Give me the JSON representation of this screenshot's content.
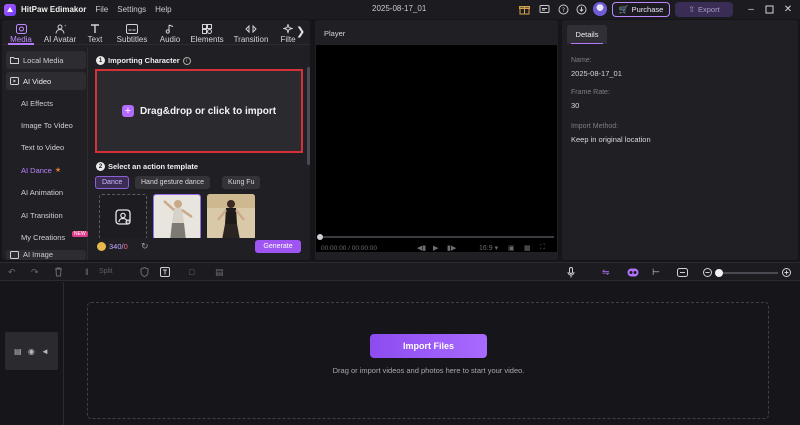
{
  "titlebar": {
    "app_name": "HitPaw Edimakor",
    "menu": [
      "File",
      "Settings",
      "Help"
    ],
    "project_title": "2025-08-17_01",
    "purchase_label": "Purchase",
    "export_label": "Export"
  },
  "tabs": [
    {
      "label": "Media",
      "icon": "media-icon",
      "active": true
    },
    {
      "label": "AI Avatar",
      "icon": "ai-avatar-icon"
    },
    {
      "label": "Text",
      "icon": "text-icon"
    },
    {
      "label": "Subtitles",
      "icon": "subtitles-icon"
    },
    {
      "label": "Audio",
      "icon": "audio-icon"
    },
    {
      "label": "Elements",
      "icon": "elements-icon"
    },
    {
      "label": "Transition",
      "icon": "transition-icon"
    },
    {
      "label": "Filte",
      "icon": "filter-icon"
    }
  ],
  "sidebar": {
    "local_media": "Local Media",
    "ai_video": "AI Video",
    "items": [
      "AI Effects",
      "Image To Video",
      "Text to Video",
      "AI Dance",
      "AI Animation",
      "AI Transition",
      "My Creations"
    ],
    "selected": "AI Dance",
    "new_badge": "NEW",
    "ai_image": "AI Image"
  },
  "importing": {
    "step1": "1",
    "title": "Importing Character",
    "drop_label": "Drag&drop or click to import"
  },
  "action": {
    "step2": "2",
    "title": "Select an action template",
    "chips": [
      "Dance",
      "Hand gesture dance",
      "Kung Fu"
    ],
    "active_chip": "Dance"
  },
  "footer": {
    "credits_used": "340",
    "credits_sep": "/",
    "credits_extra": "0",
    "generate_label": "Generate"
  },
  "player": {
    "title": "Player",
    "time": "00:00:00 / 00:00:00",
    "ratio": "16:9"
  },
  "details": {
    "tab": "Details",
    "name_label": "Name:",
    "name_value": "2025-08-17_01",
    "frame_rate_label": "Frame Rate:",
    "frame_rate_value": "30",
    "import_method_label": "Import Method:",
    "import_method_value": "Keep in original location"
  },
  "timeline": {
    "split_label": "Split",
    "import_files_label": "Import Files",
    "hint": "Drag or import videos and photos here to start your video."
  },
  "colors": {
    "accent": "#a86aff",
    "highlight_border": "#d6303a",
    "panel": "#202024"
  }
}
